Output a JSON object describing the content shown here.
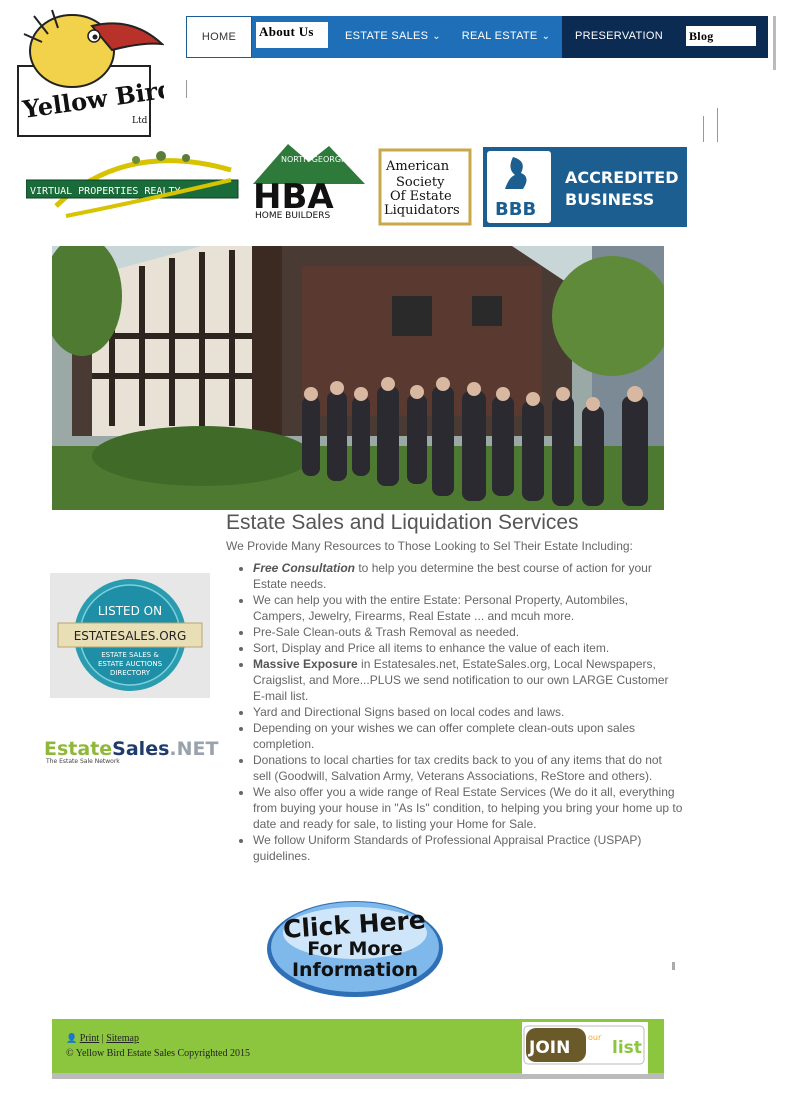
{
  "logo": {
    "text": "Yellow Bird",
    "sub": "Ltd"
  },
  "nav": {
    "home": "HOME",
    "about": "About Us",
    "estate_sales": "ESTATE SALES",
    "real_estate": "REAL ESTATE",
    "preservation": "PRESERVATION",
    "blog": "Blog"
  },
  "badges": {
    "virtual_properties": "VIRTUAL PROPERTIES REALTY",
    "hba_top": "NORTH GEORGIA",
    "hba": "HBA",
    "hba_sub": "HOME BUILDERS",
    "asel": [
      "American",
      "Society",
      "Of Estate",
      "Liquidators"
    ],
    "bbb": "BBB",
    "bbb_line1": "ACCREDITED",
    "bbb_line2": "BUSINESS"
  },
  "main": {
    "title": "Estate Sales and Liquidation Services",
    "subtitle": "We Provide Many Resources to Those Looking to Sel Their Estate Including:",
    "items": {
      "0": {
        "lead": "Free Consultation",
        "text": " to help you determine the best course of action for your Estate needs."
      },
      "1": {
        "text": "We can help you with the entire Estate: Personal Property, Autombiles, Campers, Jewelry, Firearms, Real Estate ... and mcuh more."
      },
      "2": {
        "text": "Pre-Sale Clean-outs & Trash Removal as needed."
      },
      "3": {
        "text": "Sort, Display and Price all items to enhance the value of each item."
      },
      "4": {
        "lead": "Massive Exposure",
        "text": " in Estatesales.net, EstateSales.org, Local Newspapers, Craigslist, and More...PLUS we send notification to our own LARGE Customer E-mail list."
      },
      "5": {
        "text": "Yard and Directional Signs based on local codes and laws."
      },
      "6": {
        "text": "Depending on your wishes we can offer complete clean-outs upon sales completion."
      },
      "7": {
        "text": "Donations to local charties for tax credits back to you of any items that do not sell (Goodwill, Salvation Army, Veterans Associations, ReStore and others)."
      },
      "8": {
        "text": "We also offer you a wide range of Real Estate Services (We do it all, everything from buying your house in \"As Is\" condition, to helping you bring your home up to date and ready for sale, to listing your Home for Sale."
      },
      "9": {
        "text": "We follow Uniform Standards of Professional Appraisal Practice (USPAP) guidelines."
      }
    }
  },
  "sidebar": {
    "es_org_top": "LISTED ON",
    "es_org_name": "ESTATESALES.ORG",
    "es_org_sub1": "ESTATE SALES &",
    "es_org_sub2": "ESTATE AUCTIONS",
    "es_org_sub3": "DIRECTORY",
    "es_net_a": "Estate",
    "es_net_b": "Sales",
    "es_net_c": ".NET",
    "es_net_tag": "The Estate Sale Network"
  },
  "cta": {
    "line1": "Click Here",
    "line2": "For More",
    "line3": "Information"
  },
  "footer": {
    "print": "Print",
    "sep": "|",
    "sitemap": "Sitemap",
    "copyright": "© Yellow Bird Estate Sales Copyrighted 2015",
    "join_a": "JOIN",
    "join_b": "our",
    "join_c": "list"
  },
  "colors": {
    "nav_dark": "#0b2b52",
    "nav_blue": "#1e6fb8",
    "footer_green": "#8cc63f",
    "bbb_blue": "#1b5e8f"
  }
}
